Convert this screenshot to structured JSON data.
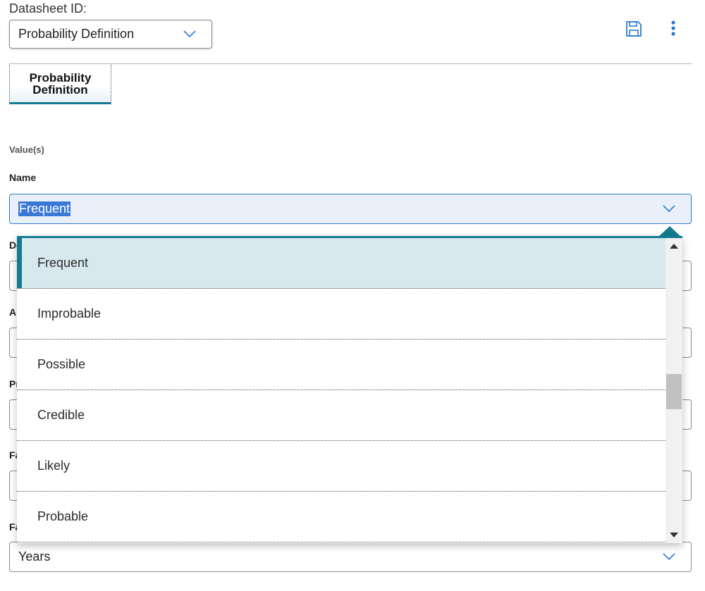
{
  "header": {
    "datasheet_label": "Datasheet ID:",
    "datasheet_value": "Probability Definition",
    "save_icon": "save-icon",
    "more_icon": "more-vertical-icon"
  },
  "tabs": [
    {
      "label": "Probability Definition",
      "active": true
    }
  ],
  "form": {
    "section_label": "Value(s)",
    "name_label": "Name",
    "name_value": "Frequent",
    "hidden_labels": [
      "De",
      "Al",
      "Pr",
      "Fa",
      "Fa"
    ],
    "years_value": "Years"
  },
  "dropdown": {
    "options": [
      "Frequent",
      "Improbable",
      "Possible",
      "Credible",
      "Likely",
      "Probable"
    ],
    "selected": "Frequent"
  },
  "colors": {
    "accent": "#147a8f",
    "focus_border": "#2b7bd0",
    "selection": "#3a78d6",
    "option_highlight": "#d7e9ed"
  }
}
